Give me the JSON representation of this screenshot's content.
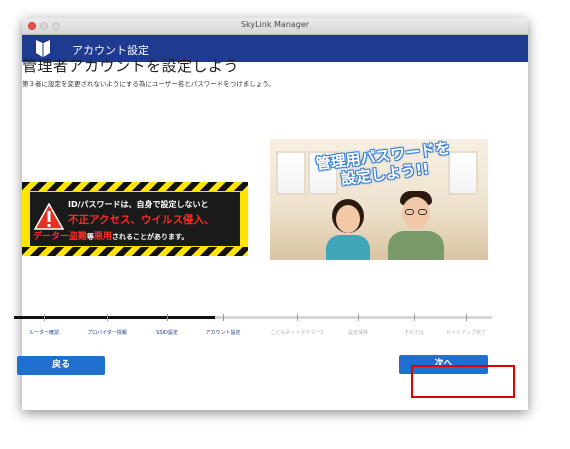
{
  "window": {
    "title": "SkyLink Manager"
  },
  "header": {
    "title": "アカウント設定",
    "logo_icon": "shield-logo-icon",
    "color": "#1f3b8f"
  },
  "main": {
    "title": "管理者アカウントを設定しよう",
    "subtitle": "第３者に設定を変更されないようにする為にユーザー名とパスワードをつけましょう。"
  },
  "warning_banner": {
    "line1": "ID/パスワードは、自身で設定しないと",
    "line2": "不正アクセス、ウイルス侵入、",
    "line3a": "データー盗難",
    "line3b": "等",
    "line3c": "悪用",
    "line3d": "されることがあります。",
    "icon": "warning-triangle-icon"
  },
  "photo": {
    "caption_line1": "管理用パスワードを",
    "caption_line2": "設定しよう!!"
  },
  "progress": {
    "completed_fraction": 0.42,
    "current_step_index": 3,
    "steps": [
      "ルーター確認",
      "プロバイダー情報",
      "SSID設定",
      "アカウント設定",
      "こどもネットタイマー2",
      "設定保存",
      "それでは",
      "セットアップ完了"
    ]
  },
  "buttons": {
    "back": "戻る",
    "next": "次へ"
  },
  "colors": {
    "accent": "#1e6fd0",
    "highlight": "#e00000",
    "warning": "#ffe400",
    "alert_text": "#ff2b22"
  }
}
